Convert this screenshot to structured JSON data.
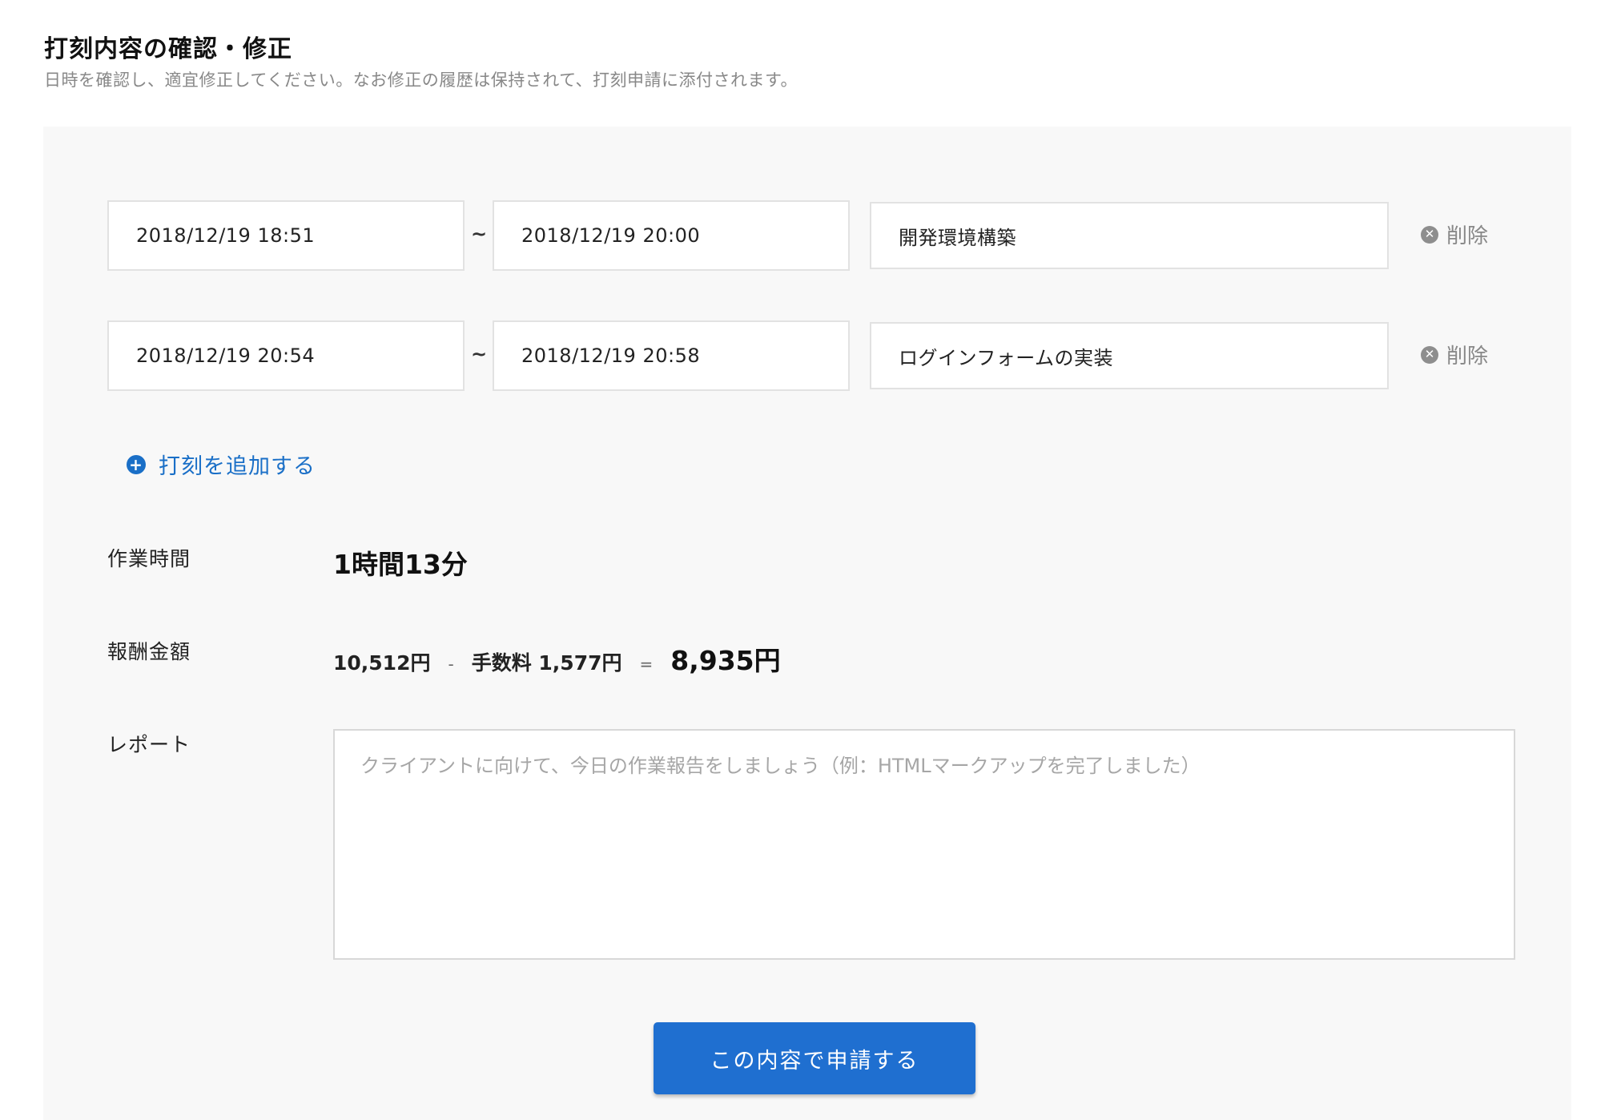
{
  "header": {
    "title": "打刻内容の確認・修正",
    "subtitle": "日時を確認し、適宜修正してください。なお修正の履歴は保持されて、打刻申請に添付されます。"
  },
  "entries": [
    {
      "start": "2018/12/19 18:51",
      "separator": "~",
      "end": "2018/12/19 20:00",
      "task": "開発環境構築",
      "delete_label": "削除"
    },
    {
      "start": "2018/12/19 20:54",
      "separator": "~",
      "end": "2018/12/19 20:58",
      "task": "ログインフォームの実装",
      "delete_label": "削除"
    }
  ],
  "add_entry_label": "打刻を追加する",
  "work_time": {
    "label": "作業時間",
    "value": "1時間13分"
  },
  "reward": {
    "label": "報酬金額",
    "gross": "10,512円",
    "minus": "-",
    "fee": "手数料 1,577円",
    "equals": "=",
    "net": "8,935円"
  },
  "report": {
    "label": "レポート",
    "placeholder": "クライアントに向けて、今日の作業報告をしましょう（例：HTMLマークアップを完了しました）",
    "value": ""
  },
  "submit_label": "この内容で申請する",
  "colors": {
    "accent": "#1f6fd0",
    "link": "#1a6fc7",
    "panel": "#f8f8f8",
    "muted": "#888888"
  },
  "icons": {
    "delete": "close-circle-icon",
    "add": "plus-circle-icon"
  }
}
